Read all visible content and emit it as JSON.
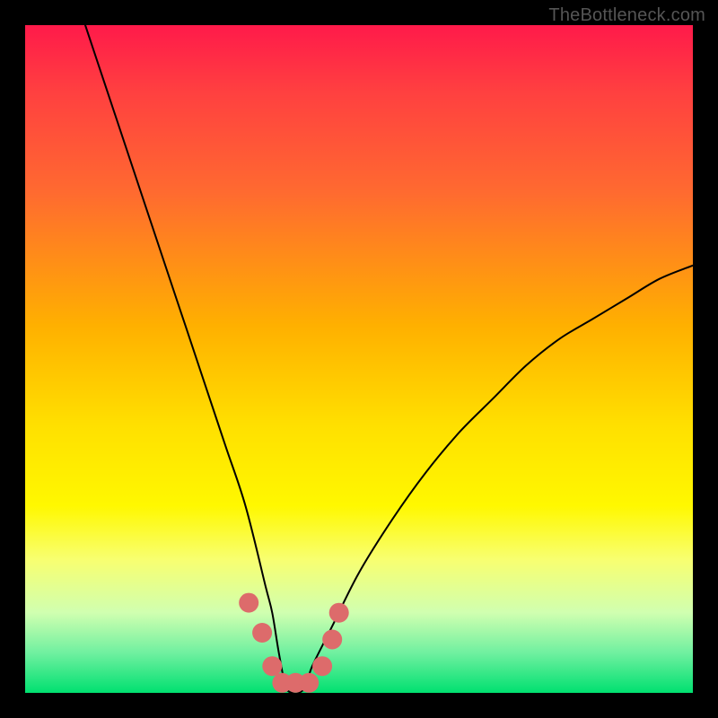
{
  "watermark": "TheBottleneck.com",
  "chart_data": {
    "type": "line",
    "title": "",
    "xlabel": "",
    "ylabel": "",
    "xlim": [
      0,
      100
    ],
    "ylim": [
      0,
      100
    ],
    "series": [
      {
        "name": "bottleneck-curve",
        "x": [
          9,
          12,
          15,
          18,
          21,
          24,
          27,
          30,
          33,
          36,
          37,
          38,
          39,
          40,
          41,
          42,
          43,
          46,
          50,
          55,
          60,
          65,
          70,
          75,
          80,
          85,
          90,
          95,
          100
        ],
        "y": [
          100,
          91,
          82,
          73,
          64,
          55,
          46,
          37,
          28,
          16,
          12,
          6,
          1,
          0,
          0,
          1,
          4,
          10,
          18,
          26,
          33,
          39,
          44,
          49,
          53,
          56,
          59,
          62,
          64
        ]
      }
    ],
    "markers": {
      "name": "highlight-dots",
      "color": "#dd6b6b",
      "x": [
        33.5,
        35.5,
        37.0,
        38.5,
        40.5,
        42.5,
        44.5,
        46.0,
        47.0
      ],
      "y": [
        13.5,
        9.0,
        4.0,
        1.5,
        1.5,
        1.5,
        4.0,
        8.0,
        12.0
      ]
    }
  }
}
